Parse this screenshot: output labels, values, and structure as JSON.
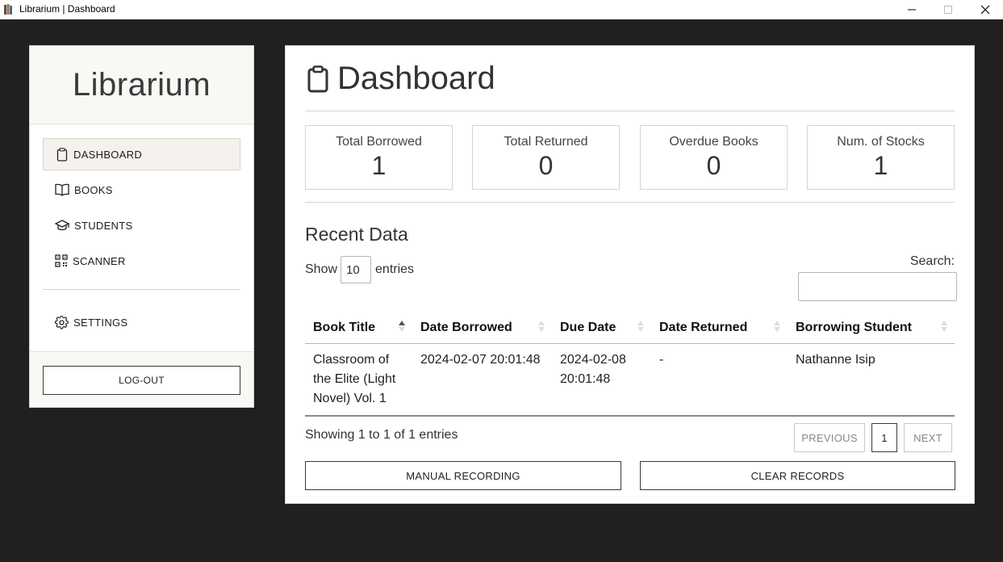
{
  "window": {
    "title": "Librarium | Dashboard"
  },
  "sidebar": {
    "brand": "Librarium",
    "items": [
      {
        "label": "DASHBOARD",
        "icon": "clipboard-icon",
        "active": true
      },
      {
        "label": "BOOKS",
        "icon": "book-open-icon",
        "active": false
      },
      {
        "label": "STUDENTS",
        "icon": "graduation-cap-icon",
        "active": false
      },
      {
        "label": "SCANNER",
        "icon": "qr-code-icon",
        "active": false
      }
    ],
    "settings": {
      "label": "SETTINGS",
      "icon": "gear-icon"
    },
    "logout_label": "LOG-OUT"
  },
  "main": {
    "title": "Dashboard",
    "title_icon": "clipboard-icon",
    "cards": [
      {
        "label": "Total Borrowed",
        "value": "1"
      },
      {
        "label": "Total Returned",
        "value": "0"
      },
      {
        "label": "Overdue Books",
        "value": "0"
      },
      {
        "label": "Num. of Stocks",
        "value": "1"
      }
    ],
    "section_title": "Recent Data",
    "show_label": "Show",
    "entries_value": "10",
    "entries_label": "entries",
    "search_label": "Search:",
    "search_value": "",
    "table": {
      "headers": [
        "Book Title",
        "Date Borrowed",
        "Due Date",
        "Date Returned",
        "Borrowing Student"
      ],
      "rows": [
        [
          "Classroom of the Elite (Light Novel) Vol. 1",
          "2024-02-07 20:01:48",
          "2024-02-08 20:01:48",
          "-",
          "Nathanne Isip"
        ]
      ]
    },
    "info": "Showing 1 to 1 of 1 entries",
    "pagination": {
      "previous": "PREVIOUS",
      "page": "1",
      "next": "NEXT"
    },
    "manual_recording_label": "MANUAL RECORDING",
    "clear_records_label": "CLEAR RECORDS"
  },
  "colors": {
    "background": "#202020",
    "panel": "#ffffff",
    "sidebar_header": "#faf8f5",
    "active_item": "#f5f1ec",
    "border": "#d6d3cf"
  }
}
